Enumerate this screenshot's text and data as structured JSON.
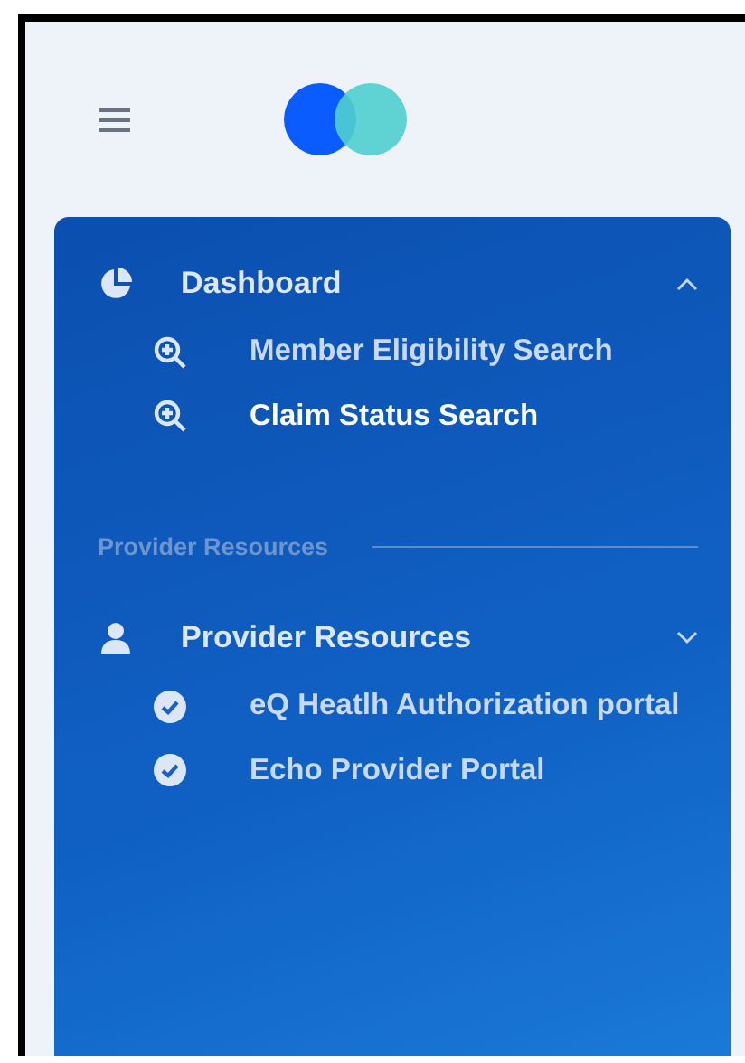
{
  "nav": [
    {
      "kind": "group",
      "label": "Dashboard",
      "expanded": true,
      "children": [
        {
          "label": "Member Eligibility Search",
          "selected": false
        },
        {
          "label": "Claim Status Search",
          "selected": true
        }
      ]
    },
    {
      "kind": "heading",
      "label": "Provider Resources"
    },
    {
      "kind": "group",
      "label": "Provider Resources",
      "expanded": false,
      "children": [
        {
          "label": "eQ Heatlh Authorization portal",
          "selected": false
        },
        {
          "label": "Echo Provider Portal",
          "selected": false
        }
      ]
    }
  ]
}
